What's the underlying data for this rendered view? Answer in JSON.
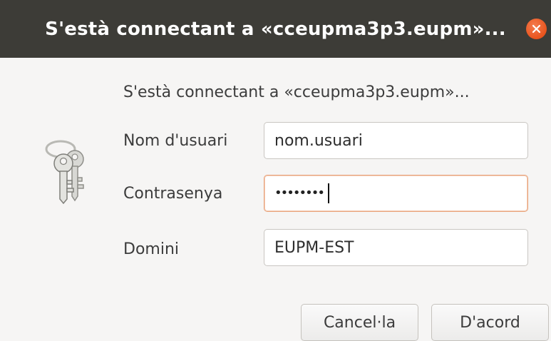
{
  "window": {
    "title": "S'està connectant a «cceupma3p3.eupm»..."
  },
  "dialog": {
    "message": "S'està connectant a «cceupma3p3.eupm»...",
    "username": {
      "label": "Nom d'usuari",
      "value": "nom.usuari"
    },
    "password": {
      "label": "Contrasenya",
      "masked_value": "••••••••"
    },
    "domain": {
      "label": "Domini",
      "value": "EUPM-EST"
    },
    "buttons": {
      "cancel": "Cancel·la",
      "ok": "D'acord"
    }
  },
  "icons": {
    "dialog_icon": "keys-icon",
    "close": "close-icon"
  },
  "colors": {
    "titlebar": "#3d3c37",
    "close_button": "#e9541d",
    "focus_border": "#e9a37b"
  }
}
